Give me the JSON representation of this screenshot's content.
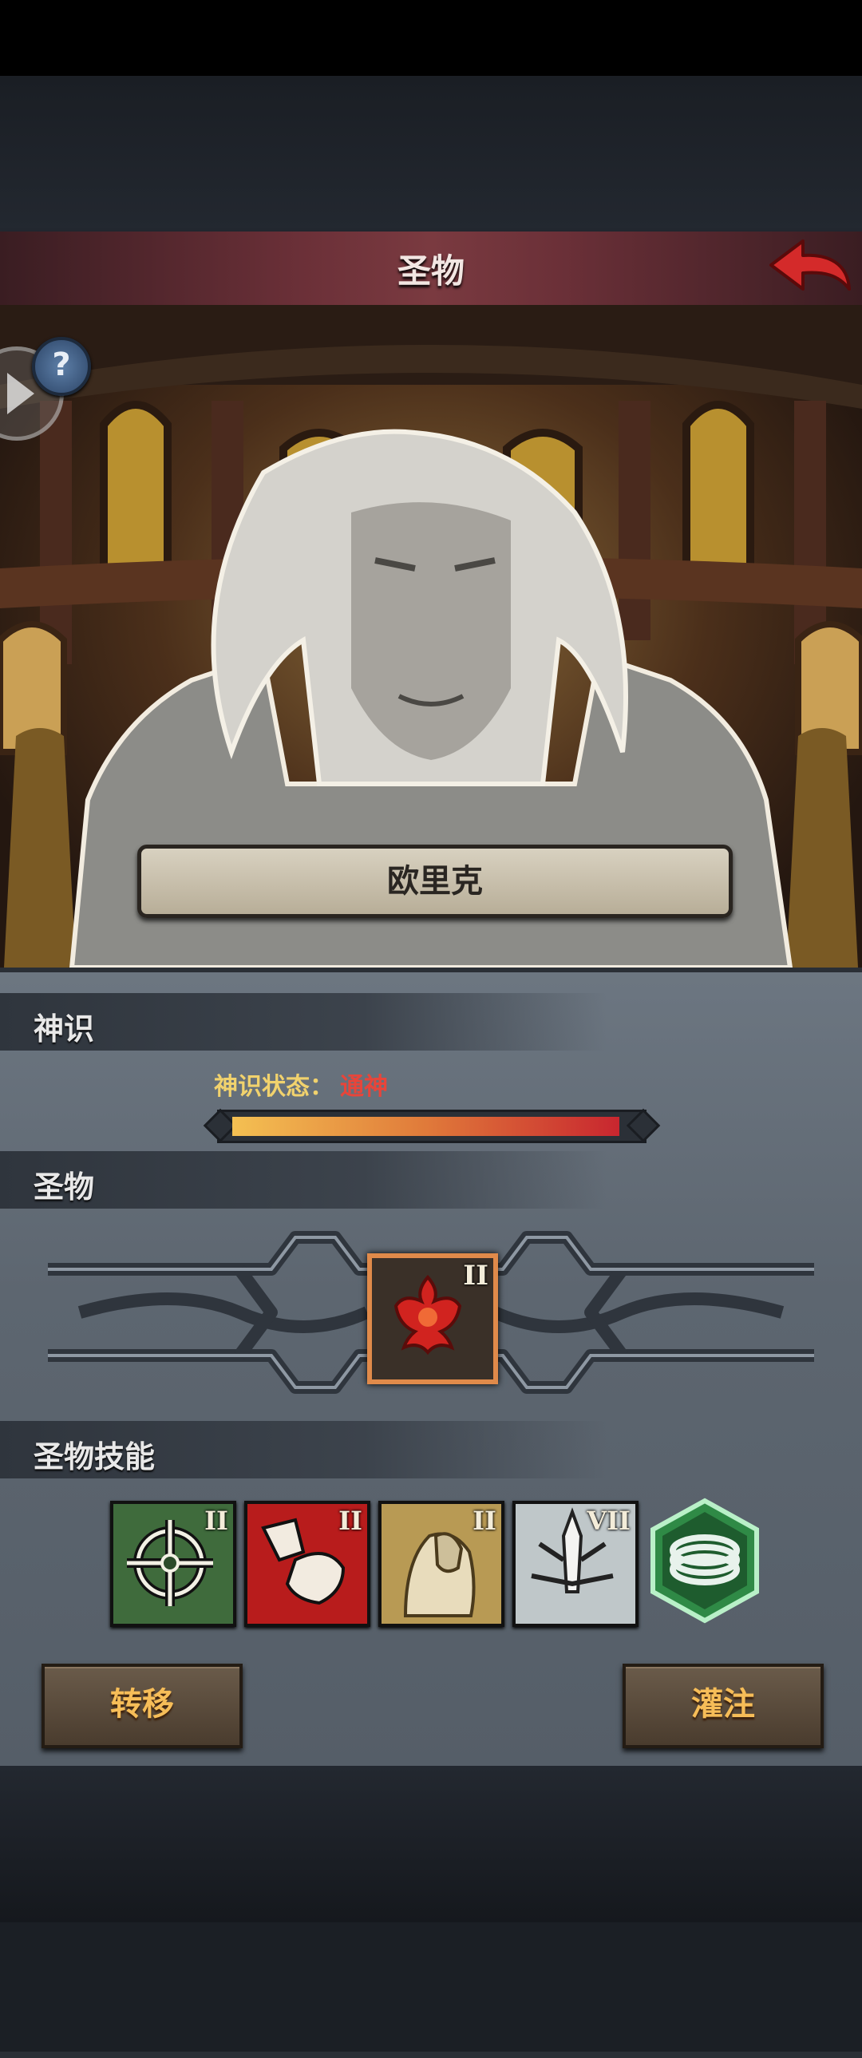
{
  "header": {
    "title": "圣物",
    "back_icon": "back-arrow-icon",
    "accent": "#c8262f"
  },
  "hero": {
    "help_label": "?",
    "name": "欧里克"
  },
  "sections": {
    "divine": {
      "title": "神识",
      "status_label": "神识状态：",
      "status_value": "通神",
      "progress": 0.97
    },
    "relic": {
      "title": "圣物",
      "slot_level": "II",
      "slot_icon": "phoenix-emblem-icon"
    },
    "skills": {
      "title": "圣物技能",
      "items": [
        {
          "icon": "crosshair-skill-icon",
          "level": "II"
        },
        {
          "icon": "fist-strike-skill-icon",
          "level": "II"
        },
        {
          "icon": "armored-knight-skill-icon",
          "level": "II"
        },
        {
          "icon": "sword-burst-skill-icon",
          "level": "VII"
        },
        {
          "icon": "coil-hex-skill-icon",
          "level": ""
        }
      ]
    }
  },
  "actions": {
    "transfer": "转移",
    "infuse": "灌注"
  }
}
